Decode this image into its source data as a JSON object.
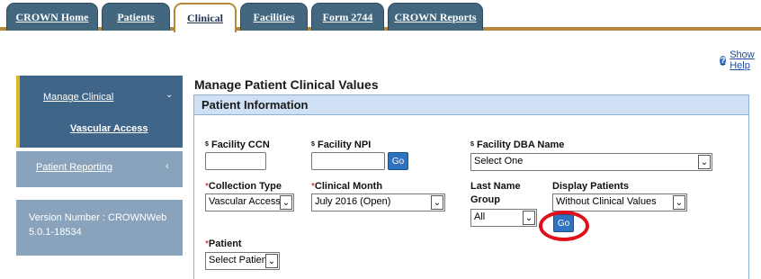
{
  "tabs": [
    {
      "label": "CROWN Home",
      "active": false
    },
    {
      "label": "Patients",
      "active": false
    },
    {
      "label": "Clinical",
      "active": true
    },
    {
      "label": "Facilities",
      "active": false
    },
    {
      "label": "Form 2744",
      "active": false
    },
    {
      "label": "CROWN Reports",
      "active": false
    }
  ],
  "help": {
    "icon": "help-icon",
    "label": "Show Help"
  },
  "sidebar": {
    "manage_clinical": "Manage Clinical",
    "vascular_access": "Vascular Access",
    "patient_reporting": "Patient Reporting",
    "version_line1": "Version Number : CROWNWeb",
    "version_line2": "5.0.1-18534"
  },
  "page_title": "Manage Patient Clinical Values",
  "panel_title": "Patient Information",
  "fields": {
    "facility_ccn": {
      "sup": "$",
      "label": "Facility CCN",
      "value": ""
    },
    "facility_npi": {
      "sup": "$",
      "label": "Facility NPI",
      "value": ""
    },
    "facility_dba": {
      "sup": "$",
      "label": "Facility DBA Name",
      "value": "Select One"
    },
    "collection_type": {
      "required": "*",
      "label": "Collection Type",
      "value": "Vascular Access"
    },
    "clinical_month": {
      "required": "*",
      "label": "Clinical Month",
      "value": "July 2016 (Open)"
    },
    "last_name_group": {
      "label_line1": "Last Name",
      "label_line2": "Group",
      "value": "All"
    },
    "display_patients": {
      "label": "Display Patients",
      "value": "Without Clinical Values"
    },
    "patient": {
      "required": "*",
      "label": "Patient",
      "value": "Select Patient"
    }
  },
  "go_label": "Go",
  "colors": {
    "tab_bg": "#43677f",
    "tab_accent": "#b48a3a",
    "sidebar_active": "#3f6688",
    "sidebar_inactive": "#8aa3bc",
    "panel_header": "#cfe0f4",
    "go_button": "#2e72c0",
    "highlight_ring": "#e0101a"
  }
}
